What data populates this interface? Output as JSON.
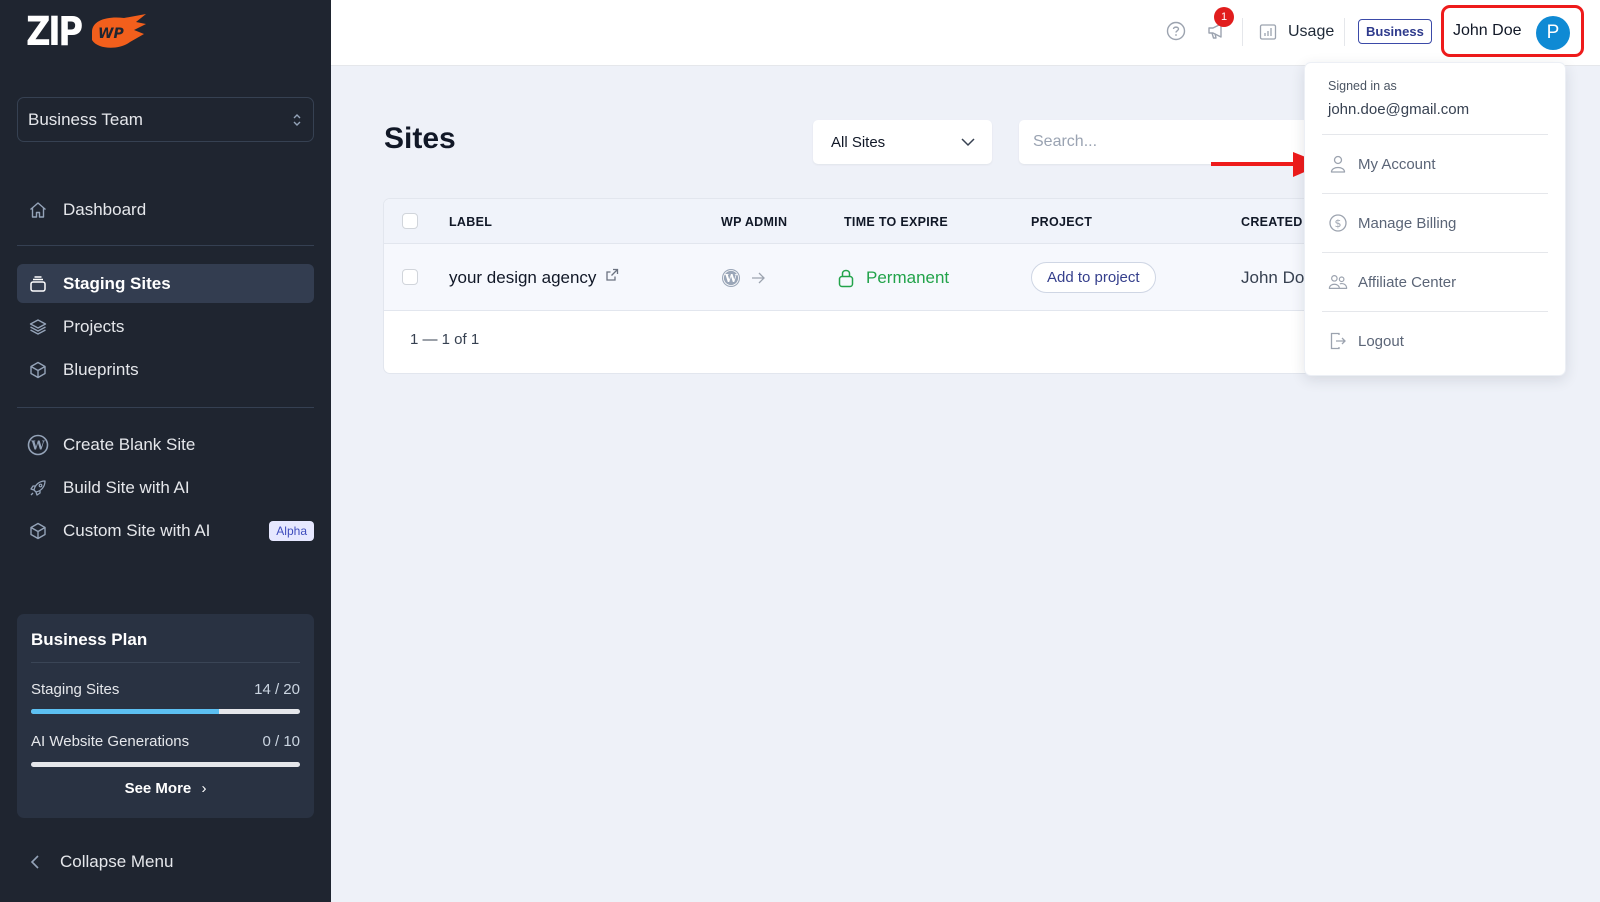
{
  "brand": {
    "logo_text": "ZIP",
    "logo_badge": "WP",
    "accent": "#f25f1c"
  },
  "sidebar": {
    "team_selector": {
      "value": "Business Team"
    },
    "items": [
      {
        "label": "Dashboard",
        "icon": "home-icon"
      },
      {
        "label": "Staging Sites",
        "icon": "archive-box-icon",
        "active": true
      },
      {
        "label": "Projects",
        "icon": "layers-icon"
      },
      {
        "label": "Blueprints",
        "icon": "cube-icon"
      },
      {
        "label": "Create Blank Site",
        "icon": "wordpress-icon"
      },
      {
        "label": "Build Site with AI",
        "icon": "rocket-icon"
      },
      {
        "label": "Custom Site with AI",
        "icon": "cube-icon",
        "badge": "Alpha"
      }
    ],
    "plan": {
      "title": "Business Plan",
      "staging": {
        "label": "Staging Sites",
        "count": "14 / 20",
        "progress": 0.7
      },
      "ai": {
        "label": "AI Website Generations",
        "count": "0 / 10",
        "progress": 0
      },
      "see_more": "See More"
    },
    "collapse_label": "Collapse Menu"
  },
  "topbar": {
    "notification_count": "1",
    "usage_label": "Usage",
    "plan_badge": "Business",
    "user_name": "John Doe",
    "avatar_initial": "P"
  },
  "main": {
    "title": "Sites",
    "filter": {
      "value": "All Sites"
    },
    "search": {
      "placeholder": "Search..."
    },
    "table": {
      "columns": [
        "LABEL",
        "WP ADMIN",
        "TIME TO EXPIRE",
        "PROJECT",
        "CREATED BY"
      ],
      "rows": [
        {
          "label": "your design agency",
          "expire": "Permanent",
          "project_action": "Add to project",
          "created_by": "John Doe"
        }
      ],
      "pagination": "1 — 1 of 1"
    }
  },
  "user_menu": {
    "signed_in_label": "Signed in as",
    "email": "john.doe@gmail.com",
    "items": [
      {
        "label": "My Account",
        "icon": "user-icon"
      },
      {
        "label": "Manage Billing",
        "icon": "dollar-circle-icon"
      },
      {
        "label": "Affiliate Center",
        "icon": "users-icon"
      },
      {
        "label": "Logout",
        "icon": "logout-icon"
      }
    ]
  },
  "colors": {
    "sidebar_bg": "#1f2530",
    "active_item_bg": "#333d50",
    "success": "#22a34a",
    "avatar_bg": "#0f8ad4",
    "highlight": "#ee1b1b",
    "progress": "#5cc0f2"
  }
}
